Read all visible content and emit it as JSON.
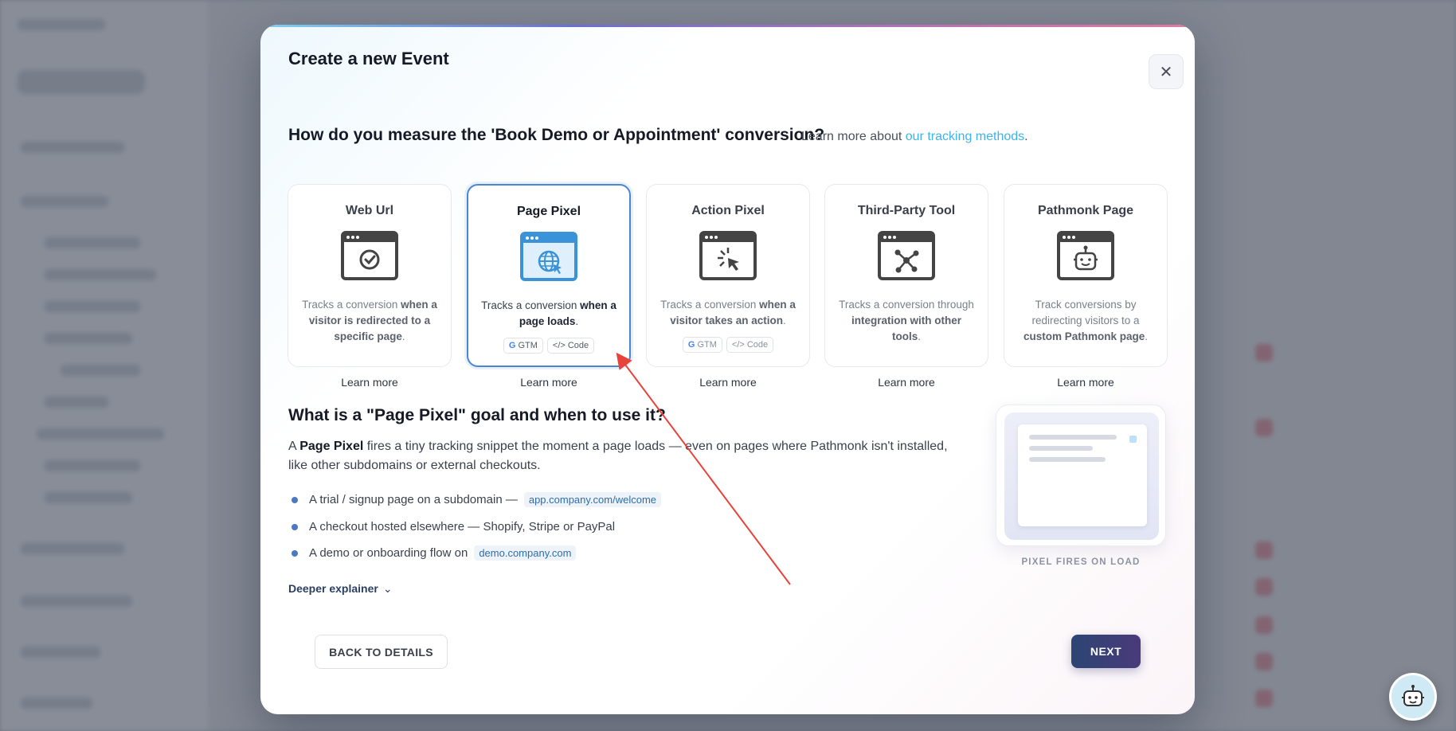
{
  "modal": {
    "title": "Create a new Event",
    "close_label": "✕"
  },
  "question": {
    "text": "How do you measure the 'Book Demo or Appointment' conversion?",
    "learn_prefix": "Learn more about ",
    "learn_link": "our tracking methods",
    "learn_suffix": "."
  },
  "cards": [
    {
      "title": "Web Url",
      "icon": "check-window-icon",
      "desc_pre": "Tracks a conversion ",
      "desc_bold": "when a visitor is redirected to a specific page",
      "desc_post": ".",
      "learn": "Learn more"
    },
    {
      "title": "Page Pixel",
      "icon": "globe-window-icon",
      "desc_pre": "Tracks a conversion ",
      "desc_bold": "when a page loads",
      "desc_post": ".",
      "tag1": "GTM",
      "tag2": "</> Code",
      "learn": "Learn more"
    },
    {
      "title": "Action Pixel",
      "icon": "cursor-window-icon",
      "desc_pre": "Tracks a conversion ",
      "desc_bold": "when a visitor takes an action",
      "desc_post": ".",
      "tag1": "GTM",
      "tag2": "</> Code",
      "learn": "Learn more"
    },
    {
      "title": "Third-Party Tool",
      "icon": "network-window-icon",
      "desc_pre": "Tracks a conversion through ",
      "desc_bold": "integration with other tools",
      "desc_post": ".",
      "learn": "Learn more"
    },
    {
      "title": "Pathmonk Page",
      "icon": "robot-window-icon",
      "desc_pre": "Track conversions by redirecting visitors to a ",
      "desc_bold": "custom Pathmonk page",
      "desc_post": ".",
      "learn": "Learn more"
    }
  ],
  "section": {
    "title": "What is a \"Page Pixel\" goal and when to use it?",
    "text_pre": "A ",
    "text_bold": "Page Pixel",
    "text_post": " fires a tiny tracking snippet the moment a page loads — even on pages where Pathmonk isn't installed, like other subdomains or external checkouts.",
    "bullets": [
      {
        "text": "A trial / signup page on a subdomain —",
        "code": "app.company.com/welcome"
      },
      {
        "text": "A checkout hosted elsewhere — Shopify, Stripe or PayPal",
        "code": ""
      },
      {
        "text": "A demo or onboarding flow on",
        "code": "demo.company.com"
      }
    ],
    "deeper": "Deeper explainer"
  },
  "illustration": {
    "caption": "PIXEL FIRES ON LOAD"
  },
  "footer": {
    "back": "BACK TO DETAILS",
    "next": "NEXT"
  },
  "colors": {
    "accent": "#3eb3e6",
    "selected_border": "#4a86d6",
    "next_bg": "#2c4573",
    "arrow": "#e8433a"
  }
}
